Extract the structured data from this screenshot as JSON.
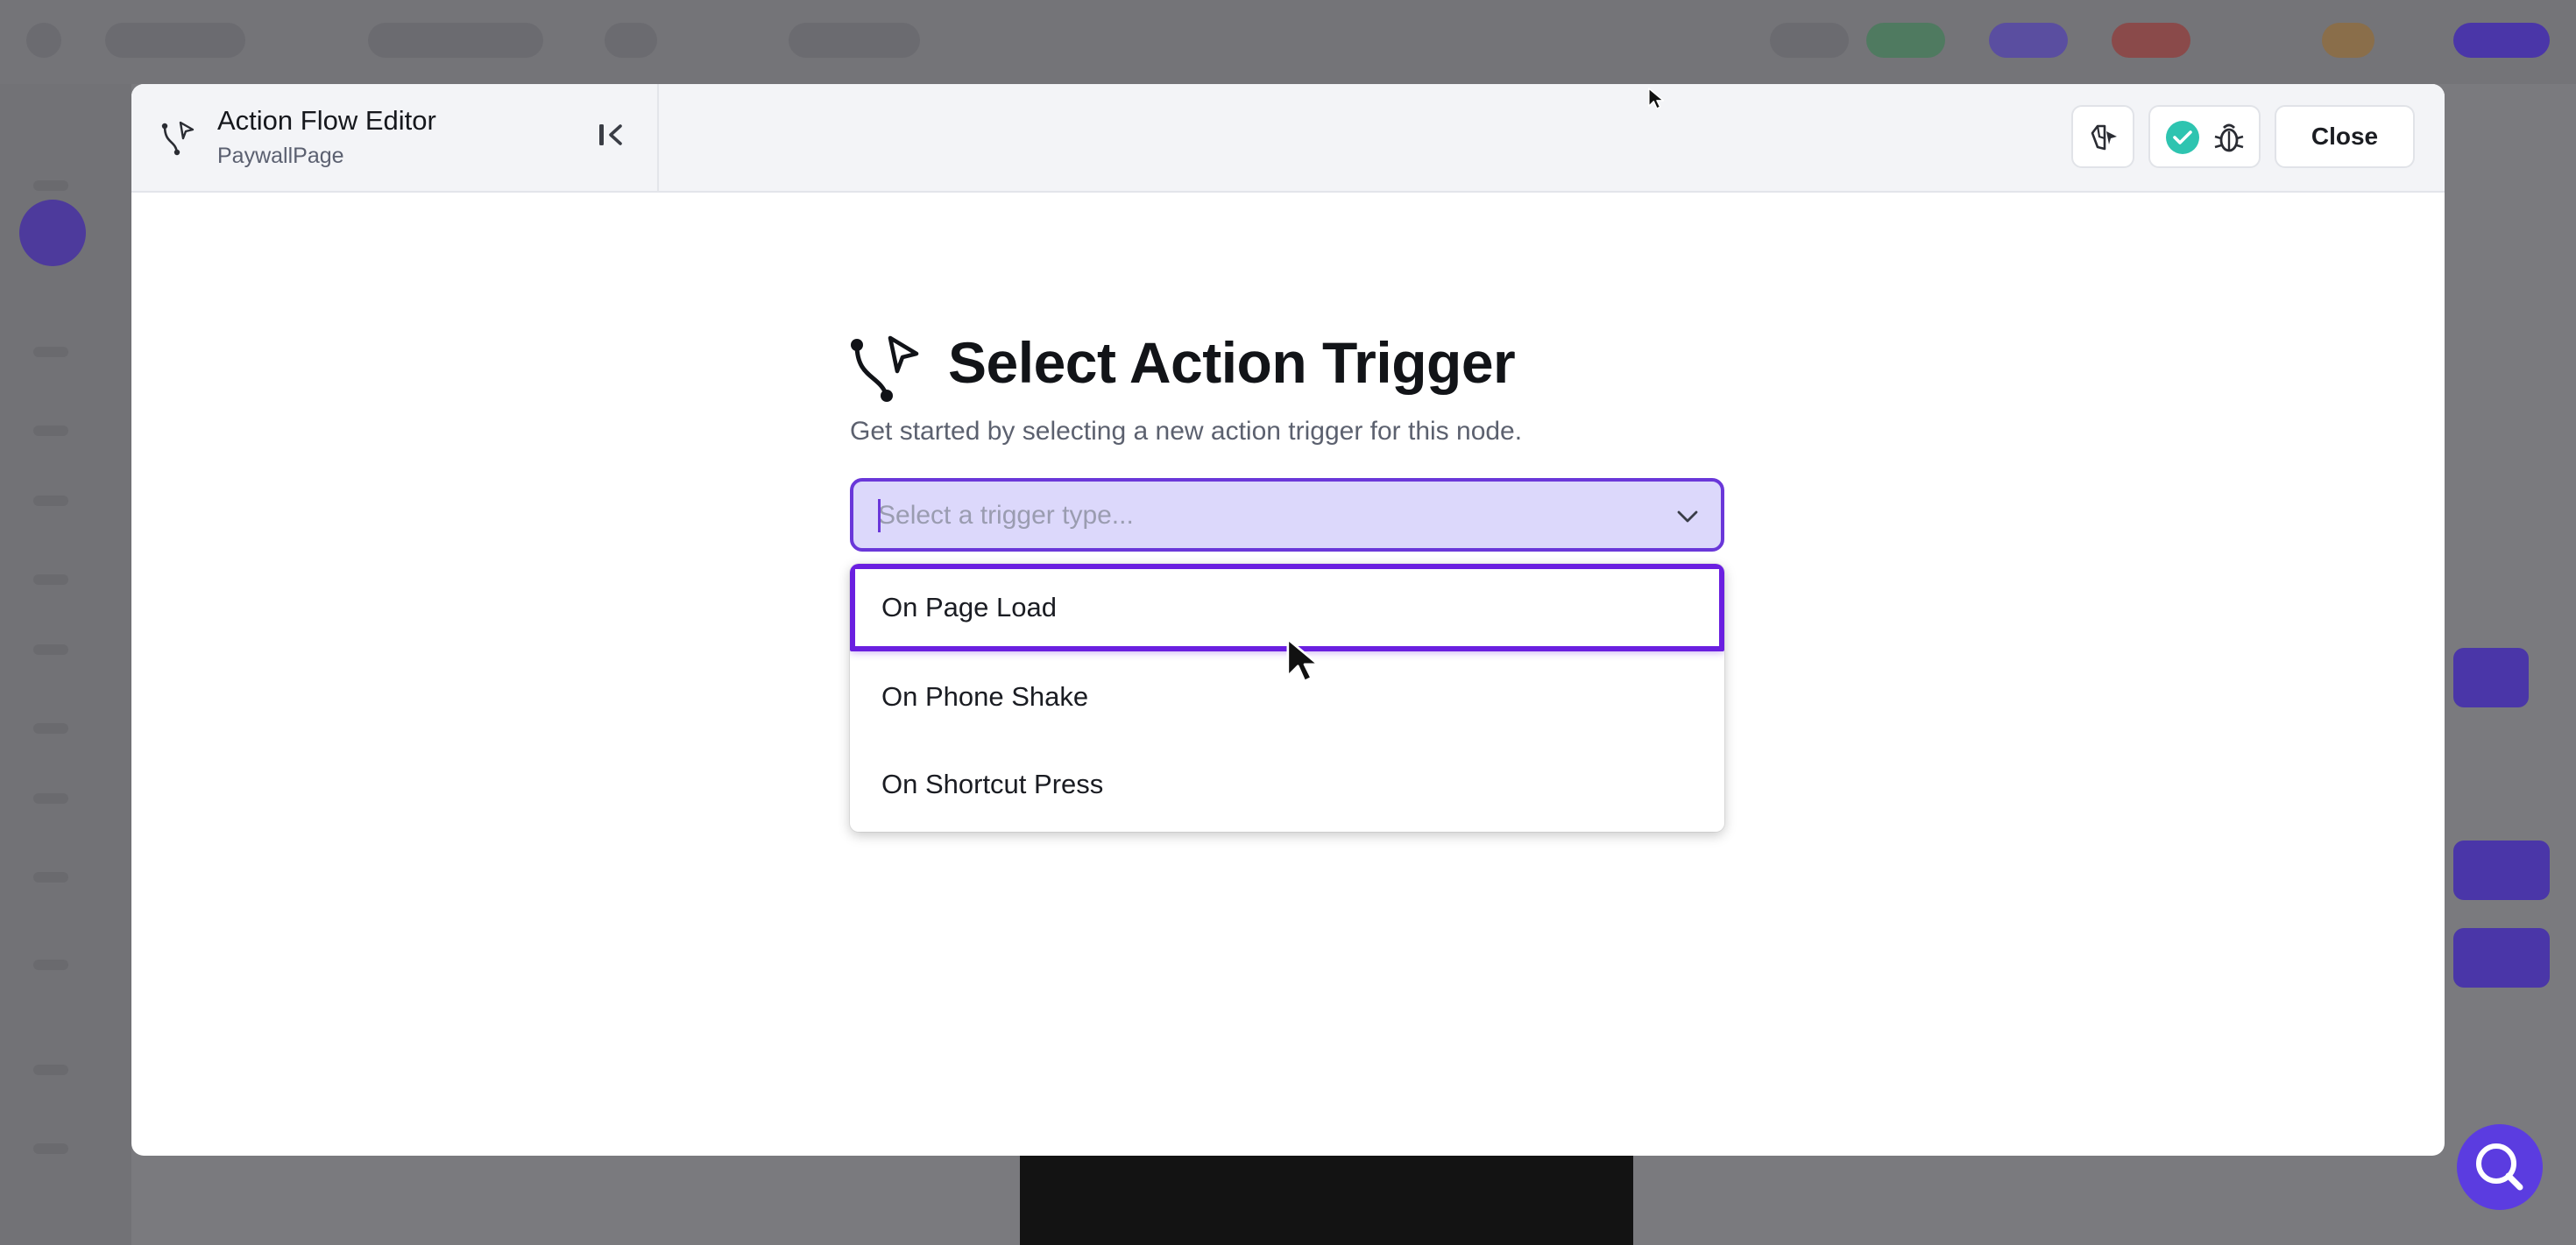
{
  "header": {
    "title": "Action Flow Editor",
    "subtitle": "PaywallPage",
    "close_label": "Close",
    "icons": {
      "flow": "action-flow-icon",
      "collapse": "collapse-panel-icon",
      "ai": "ai-assist-icon",
      "status": "check-circle-icon",
      "debug": "bug-icon"
    }
  },
  "trigger_panel": {
    "title": "Select Action Trigger",
    "description": "Get started by selecting a new action trigger for this node.",
    "select": {
      "value": "",
      "placeholder": "Select a trigger type..."
    },
    "options": [
      {
        "label": "On Page Load",
        "highlighted": true
      },
      {
        "label": "On Phone Shake",
        "highlighted": false
      },
      {
        "label": "On Shortcut Press",
        "highlighted": false
      }
    ]
  },
  "colors": {
    "accent": "#6a37d9",
    "highlight_border": "#6a1fe0",
    "select_bg": "#dcd8fb",
    "status_ok": "#2ec4b0",
    "fab": "#5b3ce0"
  },
  "fab": {
    "icon": "search-icon"
  }
}
